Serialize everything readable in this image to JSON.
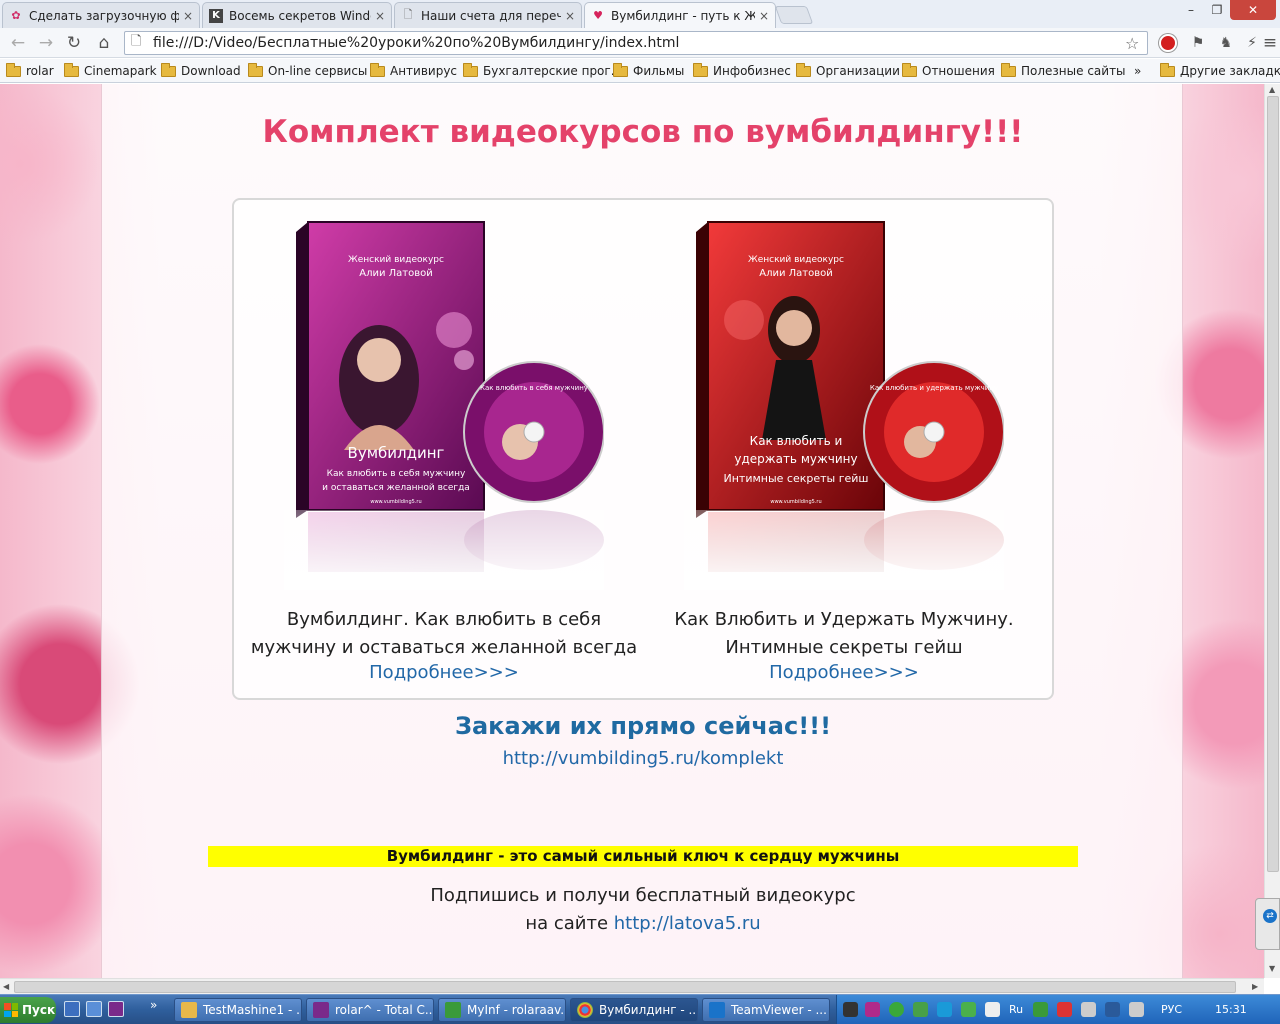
{
  "browser": {
    "tabs": [
      {
        "title": "Сделать загрузочную фл",
        "icon": "flower-favicon-icon",
        "active": false
      },
      {
        "title": "Восемь секретов Window",
        "icon": "k-favicon-icon",
        "active": false
      },
      {
        "title": "Наши счета для перечис",
        "icon": "page-icon",
        "active": false
      },
      {
        "title": "Вумбилдинг - путь к Жен",
        "icon": "heart-favicon-icon",
        "active": true
      }
    ],
    "tab_close": "×",
    "window_controls": {
      "minimize": "–",
      "restore": "❐",
      "close": "✕"
    },
    "nav": {
      "back": "←",
      "forward": "→",
      "reload": "↻",
      "home": "⌂"
    },
    "url": "file:///D:/Video/Бесплатные%20уроки%20по%20Вумбилдингу/index.html",
    "bookmarks": [
      "rolar",
      "Cinemapark",
      "Download",
      "On-line сервисы",
      "Антивирус",
      "Бухгалтерские прог...",
      "Фильмы",
      "Инфобизнес",
      "Организации",
      "Отношения",
      "Полезные сайты"
    ],
    "bookmarks_overflow": "»",
    "other_bookmarks": "Другие закладки"
  },
  "page": {
    "headline": "Комплект видеокурсов по вумбилдингу!!!",
    "products": [
      {
        "name_line1": "Вумбилдинг. Как влюбить в себя",
        "name_line2": "мужчину и оставаться желанной всегда",
        "more": "Подробнее>>>",
        "box_top": "Женский видеокурс",
        "box_author": "Алии Латовой",
        "box_title1": "Вумбилдинг",
        "box_title2": "Как влюбить в себя мужчину",
        "box_title3": "и оставаться желанной всегда",
        "box_site": "www.vumbilding5.ru",
        "disc_text": "Как влюбить в себя мужчину",
        "color": "#8a1a7a"
      },
      {
        "name_line1": "Как Влюбить и Удержать Мужчину.",
        "name_line2": "Интимные секреты гейш",
        "more": "Подробнее>>>",
        "box_top": "Женский видеокурс",
        "box_author": "Алии Латовой",
        "box_title1": "Как влюбить и",
        "box_title2": "удержать мужчину",
        "box_title3": "Интимные секреты гейш",
        "box_site": "www.vumbilding5.ru",
        "disc_text": "Как влюбить и удержать мужчину",
        "color": "#c4141e"
      }
    ],
    "order_title": "Закажи их прямо сейчас!!!",
    "order_link": "http://vumbilding5.ru/komplekt",
    "banner": "Вумбилдинг - это самый сильный ключ к сердцу мужчины",
    "subscribe_line1": "Подпишись и получи бесплатный видеокурс",
    "subscribe_line2_prefix": "на сайте",
    "subscribe_link": "http://latova5.ru"
  },
  "taskbar": {
    "start": "Пуск",
    "quicklaunch_more": "»",
    "tasks": [
      {
        "label": "TestMashine1 - ...",
        "active": false
      },
      {
        "label": "rolar^ - Total C...",
        "active": false
      },
      {
        "label": "MyInf - rolaraav...",
        "active": false
      },
      {
        "label": "Вумбилдинг - ...",
        "active": true
      },
      {
        "label": "TeamViewer - ...",
        "active": false
      }
    ],
    "lang_short": "Ru",
    "lang": "РУС",
    "clock": "15:31"
  },
  "colors": {
    "headline": "#e4426a",
    "link": "#2268a8",
    "order_title": "#1f6aa1",
    "banner_bg": "#ffff00"
  }
}
